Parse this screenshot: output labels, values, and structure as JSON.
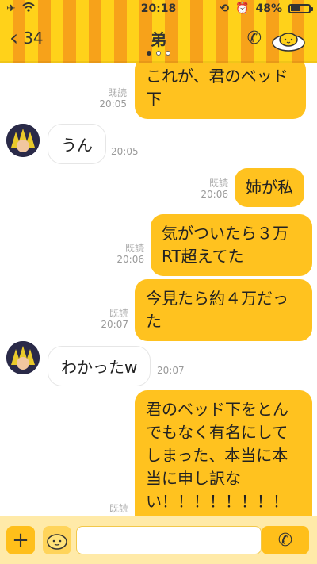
{
  "status": {
    "time": "20:18",
    "battery": "48%",
    "battery_level": 0.48
  },
  "header": {
    "back_count": "34",
    "title": "弟"
  },
  "messages": [
    {
      "side": "out",
      "text": "これが、君のベッド\n下",
      "read": "既読",
      "time": "20:05"
    },
    {
      "side": "in",
      "text": "うん",
      "time": "20:05"
    },
    {
      "side": "out",
      "text": "姉が私",
      "read": "既読",
      "time": "20:06"
    },
    {
      "side": "out",
      "text": "気がついたら３万\nRT超えてた",
      "read": "既読",
      "time": "20:06"
    },
    {
      "side": "out",
      "text": "今見たら約４万だっ\nた",
      "read": "既読",
      "time": "20:07"
    },
    {
      "side": "in",
      "text": "わかったw",
      "time": "20:07"
    },
    {
      "side": "out",
      "text": "君のベッド下をとん\nでもなく有名にして\nしまった、本当に本\n当に申し訳な\nい！！！！！！！！\n！！！！",
      "read": "既読",
      "time": ""
    }
  ],
  "composer": {
    "input_placeholder": ""
  },
  "colors": {
    "accent": "#ffc21f",
    "stripe_a": "#ffd21a",
    "stripe_b": "#f7a21a"
  },
  "icons": {
    "airplane": "airplane-icon",
    "wifi": "wifi-icon",
    "rotation_lock": "rotation-lock-icon",
    "alarm": "alarm-icon",
    "battery": "battery-icon",
    "back": "chevron-left-icon",
    "call": "phone-icon",
    "mascot": "egg-mascot-icon",
    "add": "plus-icon",
    "sticker": "sticker-icon"
  }
}
